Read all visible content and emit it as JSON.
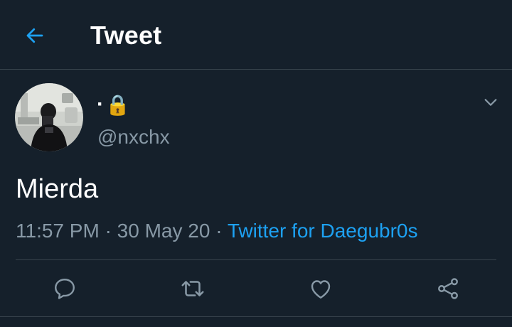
{
  "header": {
    "title": "Tweet",
    "back_icon": "arrow-left-icon",
    "accent_color": "#1da1f2"
  },
  "tweet": {
    "display_name": "·",
    "lock_emoji": "🔒",
    "handle": "@nxchx",
    "text": "Mierda",
    "time": "11:57 PM",
    "separator": "·",
    "date": "30 May 20",
    "source": "Twitter for Daegubr0s",
    "menu_icon": "chevron-down-icon"
  },
  "actions": [
    {
      "name": "reply",
      "icon": "reply-icon"
    },
    {
      "name": "retweet",
      "icon": "retweet-icon"
    },
    {
      "name": "like",
      "icon": "heart-icon"
    },
    {
      "name": "share",
      "icon": "share-icon"
    }
  ],
  "colors": {
    "background": "#15202b",
    "muted": "#8899a6",
    "divider": "#38444d"
  }
}
